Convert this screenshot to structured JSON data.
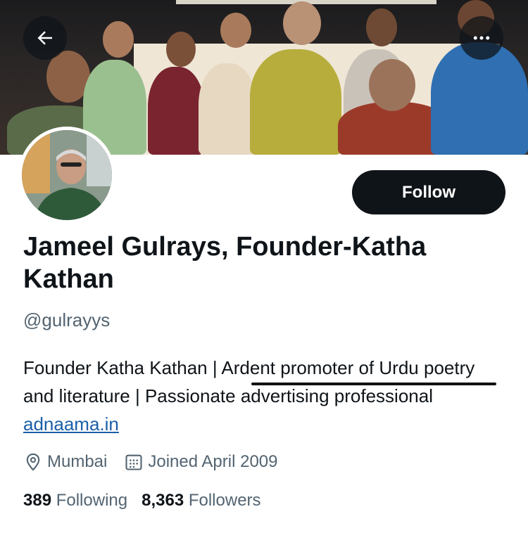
{
  "header": {
    "back_icon": "arrow-left-icon",
    "more_icon": "more-horizontal-icon"
  },
  "profile": {
    "display_name": "Jameel Gulrays, Founder-Katha Kathan",
    "handle": "@gulrayys",
    "follow_label": "Follow",
    "bio_text": "Founder Katha Kathan | Ardent promoter of Urdu poetry and literature | Passionate advertising professional ",
    "bio_link": "adnaama.in",
    "location": "Mumbai",
    "location_icon": "location-pin-icon",
    "joined": "Joined April 2009",
    "joined_icon": "calendar-icon",
    "following_count": "389",
    "following_label": "Following",
    "followers_count": "8,363",
    "followers_label": "Followers"
  },
  "colors": {
    "text_primary": "#0f1419",
    "text_secondary": "#536471",
    "link": "#1b5fa8",
    "button_bg": "#0f1419",
    "button_text": "#ffffff"
  }
}
